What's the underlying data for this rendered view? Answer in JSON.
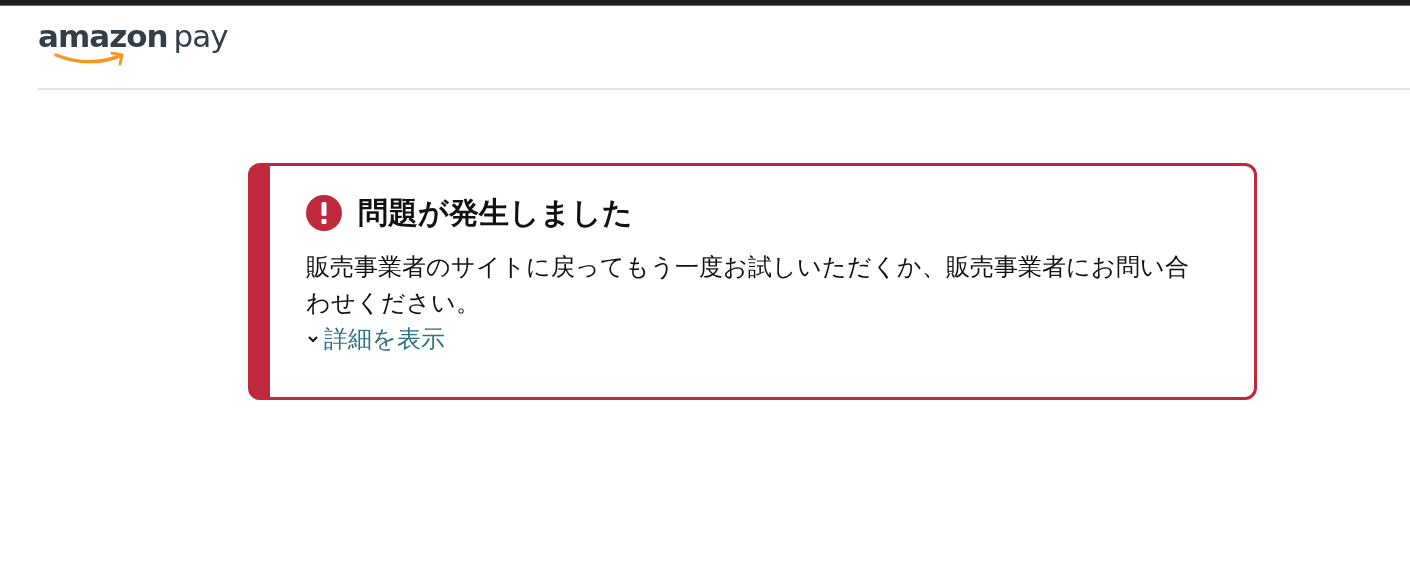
{
  "header": {
    "logo": {
      "brand": "amazon",
      "product": "pay"
    }
  },
  "alert": {
    "kind": "error",
    "title": "問題が発生しました",
    "message": "販売事業者のサイトに戻ってもう一度お試しいただくか、販売事業者にお問い合わせください。",
    "details_link": {
      "label": "詳細を表示",
      "expanded": false
    }
  }
}
